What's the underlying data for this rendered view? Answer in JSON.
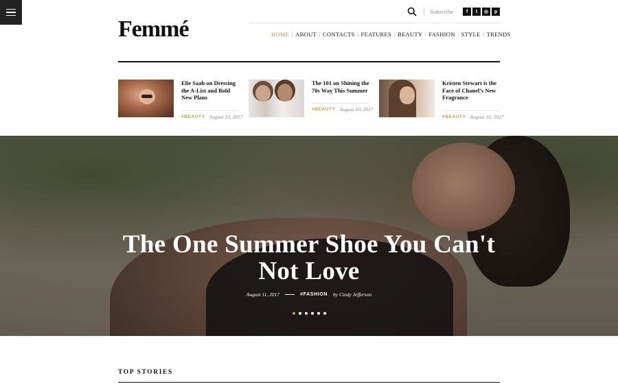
{
  "logo": "Femmé",
  "top_bar": {
    "subscribe": "Subscribe"
  },
  "social": [
    {
      "icon": "facebook-icon",
      "glyph": "f"
    },
    {
      "icon": "twitter-icon",
      "glyph": "t"
    },
    {
      "icon": "instagram-icon",
      "glyph": "◎"
    },
    {
      "icon": "pinterest-icon",
      "glyph": "p"
    }
  ],
  "nav": [
    "HOME",
    "ABOUT",
    "CONTACTS",
    "FEATURES",
    "BEAUTY",
    "FASHION",
    "STYLE",
    "TRENDS"
  ],
  "nav_active": "HOME",
  "featured": [
    {
      "title": "Elie Saab on Dressing the A-List and Bold New Plans",
      "tag": "#BEAUTY",
      "date": "August 10, 2017"
    },
    {
      "title": "The 101 on Shining the 70s Way This Summer",
      "tag": "#BEAUTY",
      "date": "August 10, 2017"
    },
    {
      "title": "Kristen Stewart is the Face of Chanel’s New Fragrance",
      "tag": "#BEAUTY",
      "date": "August 10, 2017"
    }
  ],
  "hero": {
    "title": "The One Summer Shoe You Can't Not Love",
    "date": "August 11, 2017",
    "tag": "#FASHION",
    "author": "by Cindy Jefferson",
    "slides": 6,
    "active_slide": 1
  },
  "section_title": "TOP STORIES",
  "colors": {
    "accent": "#c49a4a",
    "nav_active": "#b6935a",
    "text": "#111111"
  }
}
